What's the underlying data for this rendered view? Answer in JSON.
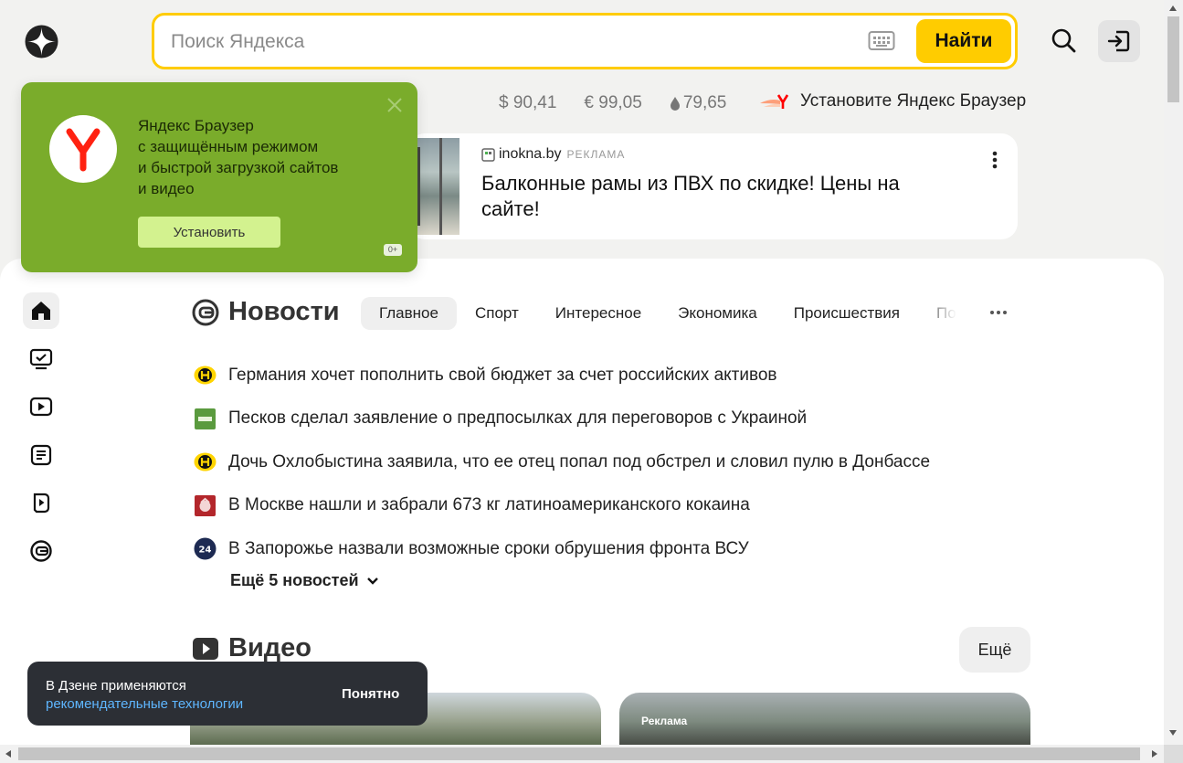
{
  "header": {
    "logo_icon": "zen-star-logo-icon",
    "search_placeholder": "Поиск Яндекса",
    "find_label": "Найти",
    "keyboard_icon": "keyboard-icon",
    "search_icon": "search-icon",
    "login_icon": "login-icon",
    "accent_color": "#ffcc00"
  },
  "rates": [
    {
      "value": "$ 90,41"
    },
    {
      "value": "€ 99,05"
    },
    {
      "value": "79,65",
      "icon": "oil-drop-icon"
    }
  ],
  "browser_promo": {
    "text": "Установите Яндекс Браузер",
    "icon": "yandex-browser-icon"
  },
  "ad": {
    "source": "inokna.by",
    "tag": "РЕКЛАМА",
    "title": "Балконные рамы из ПВХ по скидке! Цены на сайте!"
  },
  "install_popup": {
    "lines": [
      "Яндекс Браузер",
      "с защищённым режимом",
      "и быстрой загрузкой сайтов",
      "и видео"
    ],
    "button": "Установить",
    "age": "0+",
    "color": "#7aac2b"
  },
  "sidebar": {
    "items": [
      {
        "icon": "home-icon",
        "active": true
      },
      {
        "icon": "tv-check-icon"
      },
      {
        "icon": "video-icon"
      },
      {
        "icon": "article-icon"
      },
      {
        "icon": "shorts-play-icon"
      },
      {
        "icon": "news-icon"
      }
    ]
  },
  "news": {
    "title": "Новости",
    "tabs": [
      "Главное",
      "Спорт",
      "Интересное",
      "Экономика",
      "Происшествия",
      "По"
    ],
    "active_tab": 0,
    "items": [
      {
        "text": "Германия хочет пополнить свой бюджет за счет российских активов",
        "source_icon": "yellow-h-icon"
      },
      {
        "text": "Песков сделал заявление о предпосылках для переговоров с Украиной",
        "source_icon": "green-badge-icon"
      },
      {
        "text": "Дочь Охлобыстина заявила, что ее отец попал под обстрел и словил пулю в Донбассе",
        "source_icon": "yellow-h-icon"
      },
      {
        "text": "В Москве нашли и забрали 673 кг латиноамериканского кокаина",
        "source_icon": "red-emblem-icon"
      },
      {
        "text": "В Запорожье назвали возможные сроки обрушения фронта ВСУ",
        "source_icon": "blue-24-icon"
      }
    ],
    "more": "Ещё 5 новостей"
  },
  "video": {
    "title": "Видео",
    "more": "Ещё",
    "ad_label": "Реклама"
  },
  "toast": {
    "line1": "В Дзене применяются",
    "link": "рекомендательные технологии",
    "ok": "Понятно"
  }
}
